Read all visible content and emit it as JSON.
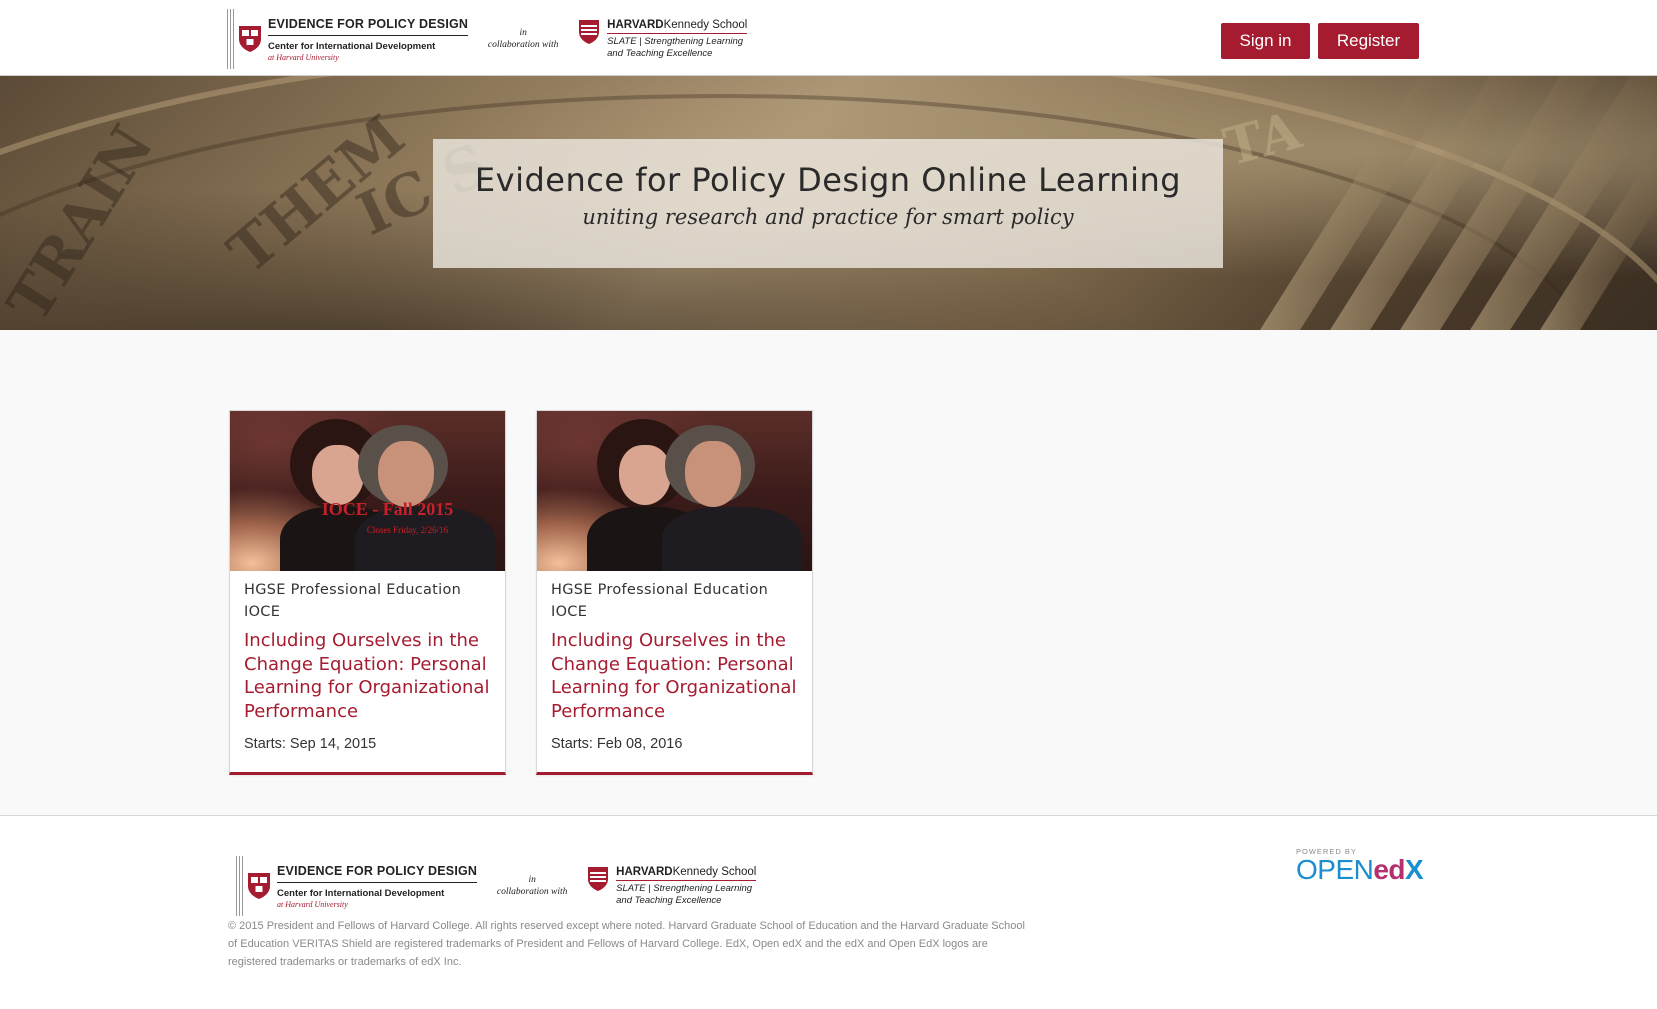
{
  "header": {
    "logo": {
      "epd_title": "EVIDENCE FOR POLICY DESIGN",
      "epd_subtitle": "Center for International Development",
      "epd_harvard": "at Harvard University",
      "collab_in": "in",
      "collab_with": "collaboration with",
      "hks_title_bold": "HARVARD",
      "hks_title_light": "Kennedy School",
      "hks_sub_1": "SLATE | Strengthening Learning",
      "hks_sub_2": "and Teaching Excellence"
    },
    "signin_label": "Sign in",
    "register_label": "Register"
  },
  "hero": {
    "title": "Evidence for Policy Design Online Learning",
    "subtitle": "uniting research and practice for smart policy"
  },
  "courses": [
    {
      "image_title": "IOCE - Fall 2015",
      "image_subtitle": "Closes Friday, 2/26/16",
      "org": "HGSE Professional Education",
      "code": "IOCE",
      "title": "Including Ourselves in the Change Equation: Personal Learning for Organizational Performance",
      "start": "Starts: Sep 14, 2015"
    },
    {
      "image_title": "",
      "image_subtitle": "",
      "org": "HGSE Professional Education",
      "code": "IOCE",
      "title": "Including Ourselves in the Change Equation: Personal Learning for Organizational Performance",
      "start": "Starts: Feb 08, 2016"
    }
  ],
  "footer": {
    "copyright": "© 2015 President and Fellows of Harvard College. All rights reserved except where noted. Harvard Graduate School of Education and the Harvard Graduate School of Education VERITAS Shield are registered trademarks of President and Fellows of Harvard College. EdX, Open edX and the edX and Open EdX logos are registered trademarks or trademarks of edX Inc.",
    "powered_by": "POWERED BY",
    "open_label": "OPEN",
    "ed_label": "ed",
    "x_label": "X"
  },
  "colors": {
    "brand_crimson": "#a51c30",
    "openedx_blue": "#1a8ece",
    "openedx_magenta": "#b4316e"
  },
  "icons": [
    "harvard-shield-icon",
    "hks-shield-icon"
  ]
}
